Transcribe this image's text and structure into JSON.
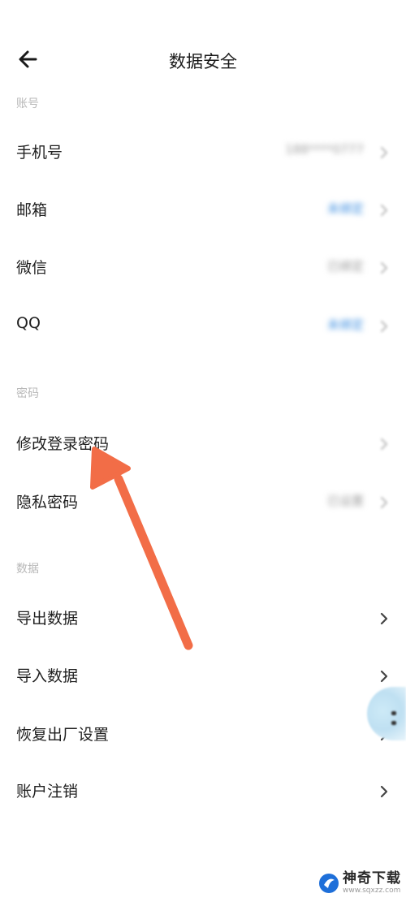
{
  "header": {
    "title": "数据安全",
    "back_icon": "back-arrow-icon"
  },
  "sections": {
    "account": {
      "label": "账号",
      "items": [
        {
          "label": "手机号",
          "value": "188****0777"
        },
        {
          "label": "邮箱",
          "value": "未绑定"
        },
        {
          "label": "微信",
          "value": "已绑定"
        },
        {
          "label": "QQ",
          "value": "未绑定"
        }
      ]
    },
    "password": {
      "label": "密码",
      "items": [
        {
          "label": "修改登录密码"
        },
        {
          "label": "隐私密码",
          "value": "已设置"
        }
      ]
    },
    "data": {
      "label": "数据",
      "items": [
        {
          "label": "导出数据"
        },
        {
          "label": "导入数据"
        },
        {
          "label": "恢复出厂设置"
        },
        {
          "label": "账户注销"
        }
      ]
    }
  },
  "watermark": {
    "name": "神奇下载",
    "url": "www.sqxzz.com"
  },
  "colors": {
    "annotation_arrow": "#f26d47",
    "link_value": "#3b8de0",
    "muted_text": "#b8b8b8"
  }
}
